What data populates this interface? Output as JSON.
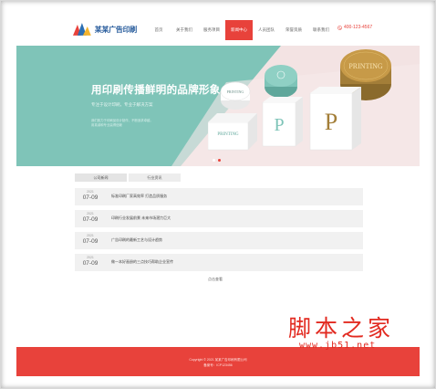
{
  "header": {
    "logo_text": "某某广告印刷",
    "nav": [
      "首页",
      "关于我们",
      "服务项目",
      "新闻中心",
      "人员团队",
      "荣誉资质",
      "联系我们"
    ],
    "active_index": 3,
    "phone": "400-123-4567"
  },
  "banner": {
    "title": "用印刷传播鲜明的品牌形象",
    "subtitle": "专注于设计印刷，专业于解决方案",
    "desc": "我们致力于印刷品设计制作、不断追求卓越，用真诚和专业赢得信赖",
    "product_labels": [
      "PRINTING",
      "PRINTING",
      "PRINTING",
      "P",
      "P"
    ],
    "dot_count": 2,
    "active_dot": 1
  },
  "tabs": [
    "公司新闻",
    "行业资讯"
  ],
  "news": [
    {
      "year": "2021",
      "date": "07-09",
      "title": "标准印刷厂家高效率 打造品质服务"
    },
    {
      "year": "2021",
      "date": "07-09",
      "title": "印刷行业发展前景 未来市场潜力巨大"
    },
    {
      "year": "2021",
      "date": "07-09",
      "title": "广告印刷的最新工艺与设计趋势"
    },
    {
      "year": "2021",
      "date": "07-09",
      "title": "做一本好画册的三点技巧帮助企业宣传"
    }
  ],
  "more_label": "点击查看",
  "footer": {
    "copyright": "Copyright © 2021 某某广告印刷有限公司",
    "icp": "备案号：ICP123456"
  },
  "watermark": {
    "main": "脚本之家",
    "url": "www.jb51.net"
  },
  "colors": {
    "accent": "#e8423b",
    "teal": "#7ec4b8",
    "pink": "#f4e4e4"
  }
}
